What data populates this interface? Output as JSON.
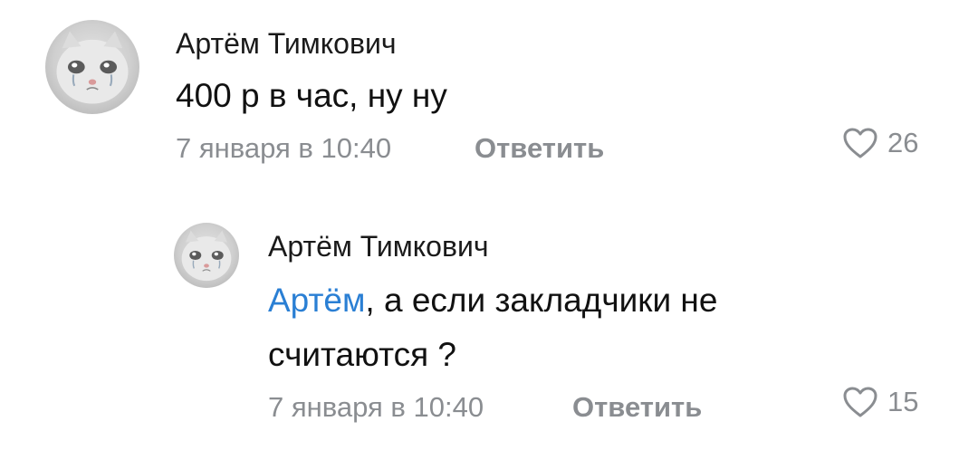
{
  "comments": [
    {
      "author": "Артём Тимкович",
      "text": "400 р в час, ну ну",
      "date": "7 января в 10:40",
      "reply_label": "Ответить",
      "likes": "26"
    },
    {
      "author": "Артём Тимкович",
      "mention": "Артём",
      "text_line1": ", а если закладчики не",
      "text_line2": "считаются ?",
      "date": "7 января в 10:40",
      "reply_label": "Ответить",
      "likes": "15"
    }
  ],
  "colors": {
    "mention": "#2a7fd4",
    "meta": "#8a8d91",
    "text": "#111111"
  },
  "icons": {
    "avatar": "sad-cat-avatar",
    "like": "heart-outline-icon"
  }
}
